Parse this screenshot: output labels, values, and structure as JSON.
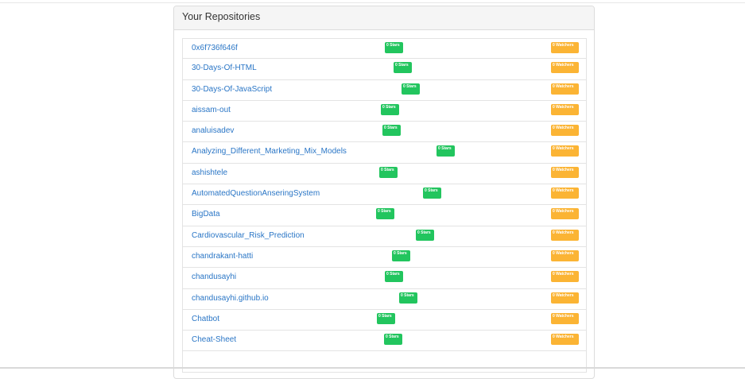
{
  "panel": {
    "title": "Your Repositories"
  },
  "colors": {
    "stars": "#22c55e",
    "watchers": "#fbb434",
    "link": "#2a76c6"
  },
  "repos": [
    {
      "name": "0x6f736f646f",
      "stars": "0 Stars",
      "watchers": "0 Watchers"
    },
    {
      "name": "30-Days-Of-HTML",
      "stars": "0 Stars",
      "watchers": "0 Watchers"
    },
    {
      "name": "30-Days-Of-JavaScript",
      "stars": "0 Stars",
      "watchers": "0 Watchers"
    },
    {
      "name": "aissam-out",
      "stars": "0 Stars",
      "watchers": "0 Watchers"
    },
    {
      "name": "analuisadev",
      "stars": "0 Stars",
      "watchers": "0 Watchers"
    },
    {
      "name": "Analyzing_Different_Marketing_Mix_Models",
      "stars": "0 Stars",
      "watchers": "0 Watchers"
    },
    {
      "name": "ashishtele",
      "stars": "0 Stars",
      "watchers": "0 Watchers"
    },
    {
      "name": "AutomatedQuestionAnseringSystem",
      "stars": "0 Stars",
      "watchers": "0 Watchers"
    },
    {
      "name": "BigData",
      "stars": "0 Stars",
      "watchers": "0 Watchers"
    },
    {
      "name": "Cardiovascular_Risk_Prediction",
      "stars": "0 Stars",
      "watchers": "0 Watchers"
    },
    {
      "name": "chandrakant-hatti",
      "stars": "0 Stars",
      "watchers": "0 Watchers"
    },
    {
      "name": "chandusayhi",
      "stars": "0 Stars",
      "watchers": "0 Watchers"
    },
    {
      "name": "chandusayhi.github.io",
      "stars": "0 Stars",
      "watchers": "0 Watchers"
    },
    {
      "name": "Chatbot",
      "stars": "0 Stars",
      "watchers": "0 Watchers"
    },
    {
      "name": "Cheat-Sheet",
      "stars": "0 Stars",
      "watchers": "0 Watchers"
    },
    {
      "name": "",
      "stars": "",
      "watchers": ""
    }
  ]
}
